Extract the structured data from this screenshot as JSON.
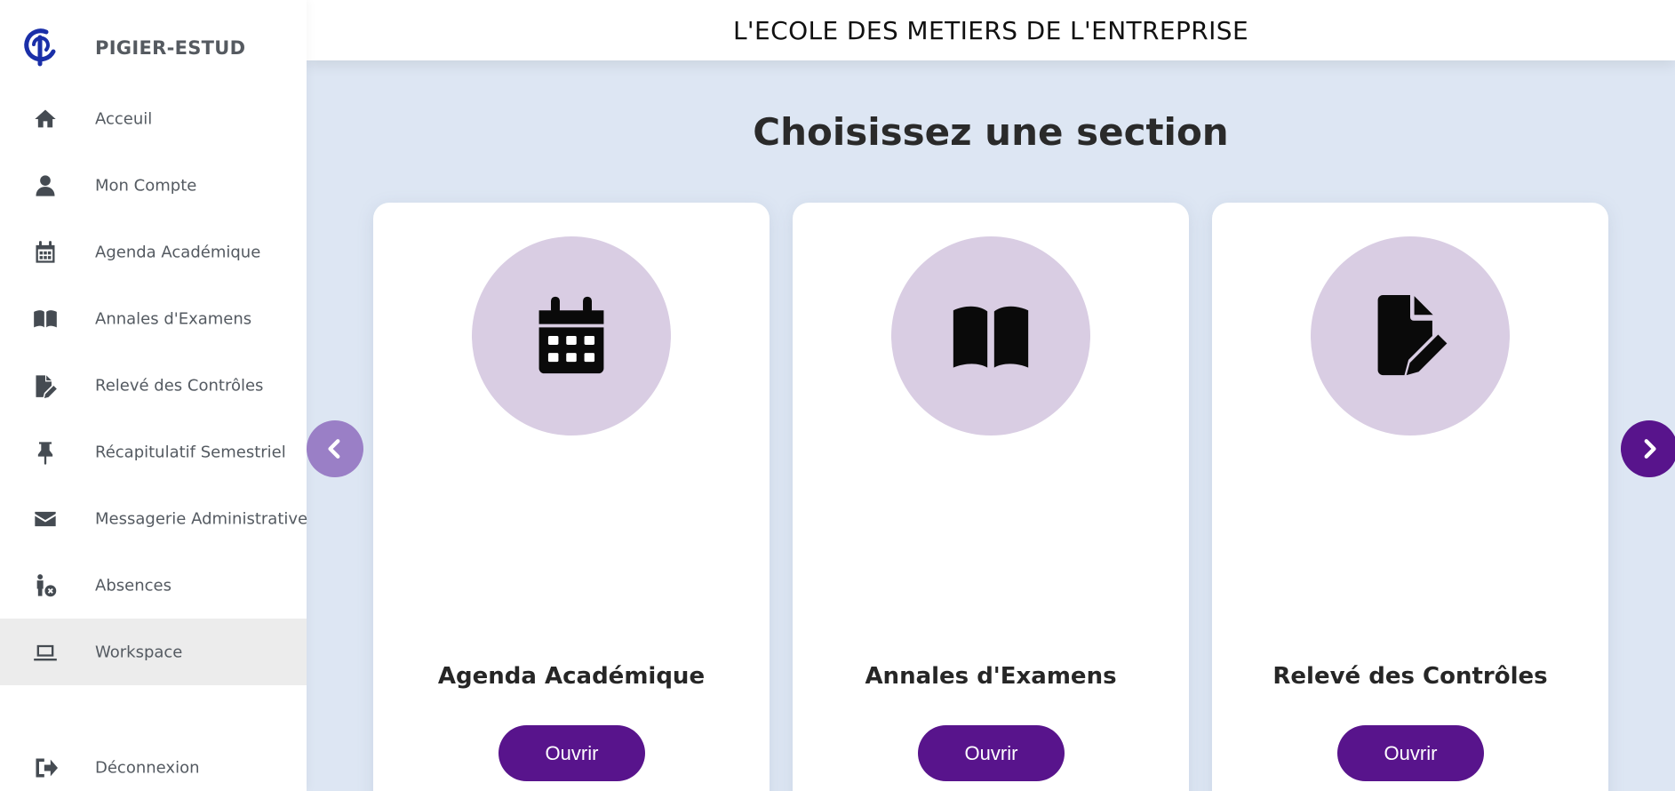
{
  "brand": {
    "name": "PIGIER-ESTUD",
    "logo_color": "#1a2fa8"
  },
  "sidebar": {
    "items": [
      {
        "label": "Acceuil",
        "icon": "home-icon",
        "active": false
      },
      {
        "label": "Mon Compte",
        "icon": "user-icon",
        "active": false
      },
      {
        "label": "Agenda Académique",
        "icon": "calendar-icon",
        "active": false
      },
      {
        "label": "Annales d'Examens",
        "icon": "book-open-icon",
        "active": false
      },
      {
        "label": "Relevé des Contrôles",
        "icon": "file-edit-icon",
        "active": false
      },
      {
        "label": "Récapitulatif Semestriel",
        "icon": "thumbtack-icon",
        "active": false
      },
      {
        "label": "Messagerie Administrative",
        "icon": "envelope-icon",
        "active": false
      },
      {
        "label": "Absences",
        "icon": "person-x-icon",
        "active": false
      },
      {
        "label": "Workspace",
        "icon": "laptop-icon",
        "active": true
      }
    ],
    "logout": {
      "label": "Déconnexion",
      "icon": "logout-icon"
    }
  },
  "header": {
    "title": "L'ECOLE DES METIERS DE L'ENTREPRISE"
  },
  "main": {
    "title": "Choisissez une section",
    "cards": [
      {
        "title": "Agenda Académique",
        "button": "Ouvrir",
        "icon": "calendar-icon"
      },
      {
        "title": "Annales d'Examens",
        "button": "Ouvrir",
        "icon": "book-open-icon"
      },
      {
        "title": "Relevé des Contrôles",
        "button": "Ouvrir",
        "icon": "file-edit-icon"
      }
    ]
  },
  "colors": {
    "accent": "#58148c",
    "accent_light": "#9a7fc6",
    "circle_bg": "#d9cde3",
    "page_bg": "#dde6f3",
    "active_nav_bg": "#ececec"
  }
}
